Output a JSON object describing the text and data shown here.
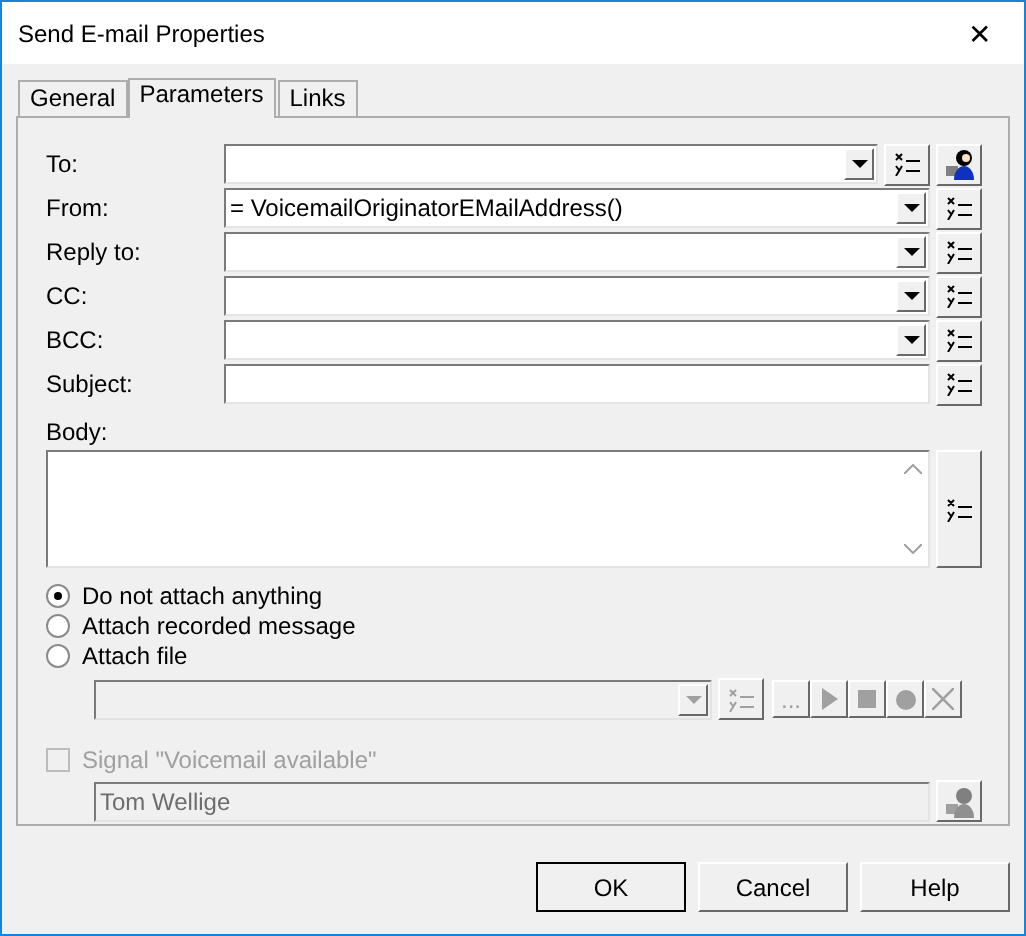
{
  "window": {
    "title": "Send E-mail Properties",
    "close": "✕"
  },
  "tabs": [
    {
      "label": "General",
      "selected": false
    },
    {
      "label": "Parameters",
      "selected": true
    },
    {
      "label": "Links",
      "selected": false
    }
  ],
  "fields": [
    {
      "label": "To:",
      "kind": "combo",
      "contact_button": true
    },
    {
      "label": "From:",
      "kind": "combo",
      "value": "= VoicemailOriginatorEMailAddress()",
      "contact_button": false
    },
    {
      "label": "Reply to:",
      "kind": "combo",
      "contact_button": false
    },
    {
      "label": "CC:",
      "kind": "combo",
      "contact_button": false
    },
    {
      "label": "BCC:",
      "kind": "combo",
      "contact_button": false
    },
    {
      "label": "Subject:",
      "kind": "text",
      "contact_button": false
    }
  ],
  "body": {
    "label": "Body:"
  },
  "attach_options": [
    {
      "label": "Do not attach anything",
      "selected": true
    },
    {
      "label": "Attach recorded message",
      "selected": false
    },
    {
      "label": "Attach file",
      "selected": false
    }
  ],
  "attach_file": {
    "disabled": true,
    "browse": "..."
  },
  "signal": {
    "label": "Signal \"Voicemail available\"",
    "checked": false,
    "disabled": true,
    "name": "Tom Wellige"
  },
  "buttons": [
    {
      "label": "OK",
      "default": true
    },
    {
      "label": "Cancel",
      "default": false
    },
    {
      "label": "Help",
      "default": false
    }
  ]
}
